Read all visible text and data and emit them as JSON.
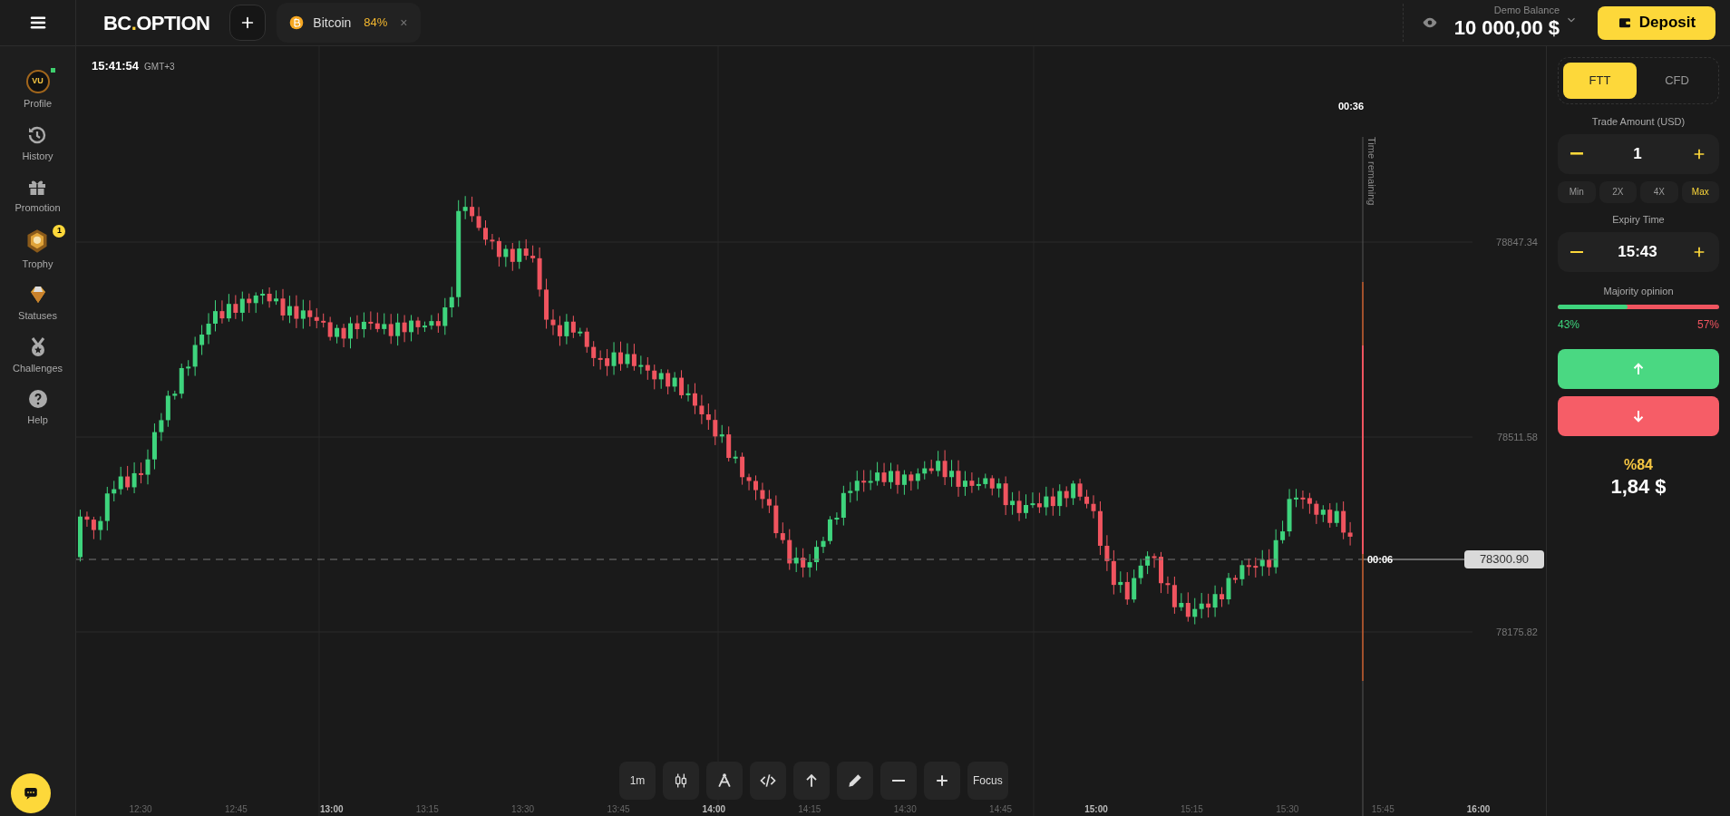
{
  "top_bar": {
    "logo_parts": [
      "BC",
      ".",
      "OPTION"
    ],
    "asset_tab": {
      "name": "Bitcoin",
      "payout": "84%",
      "close": "×"
    },
    "balance": {
      "label": "Demo Balance",
      "amount": "10 000,00 $"
    },
    "deposit_button": "Deposit"
  },
  "sidebar": {
    "items": [
      {
        "label": "Profile",
        "kind": "avatar",
        "avatar_text": "VU",
        "online": true
      },
      {
        "label": "History",
        "kind": "history"
      },
      {
        "label": "Promotion",
        "kind": "gift"
      },
      {
        "label": "Trophy",
        "kind": "trophy",
        "badge": "1"
      },
      {
        "label": "Statuses",
        "kind": "gem"
      },
      {
        "label": "Challenges",
        "kind": "medal"
      },
      {
        "label": "Help",
        "kind": "help"
      }
    ]
  },
  "chart": {
    "clock": "15:41:54",
    "timezone": "GMT+3",
    "price_levels": [
      "78847.34",
      "78511.58",
      "78175.82"
    ],
    "current_price": "78300.90",
    "countdown": "00:36",
    "time_remaining_label": "Time remaining",
    "candle_timer": "00:06",
    "time_axis": [
      {
        "label": "12:30",
        "major": false
      },
      {
        "label": "12:45",
        "major": false
      },
      {
        "label": "13:00",
        "major": true
      },
      {
        "label": "13:15",
        "major": false
      },
      {
        "label": "13:30",
        "major": false
      },
      {
        "label": "13:45",
        "major": false
      },
      {
        "label": "14:00",
        "major": true
      },
      {
        "label": "14:15",
        "major": false
      },
      {
        "label": "14:30",
        "major": false
      },
      {
        "label": "14:45",
        "major": false
      },
      {
        "label": "15:00",
        "major": true
      },
      {
        "label": "15:15",
        "major": false
      },
      {
        "label": "15:30",
        "major": false
      },
      {
        "label": "15:45",
        "major": false
      },
      {
        "label": "16:00",
        "major": true
      }
    ]
  },
  "toolbar": [
    {
      "kind": "text",
      "label": "1m"
    },
    {
      "kind": "candles"
    },
    {
      "kind": "compass"
    },
    {
      "kind": "code"
    },
    {
      "kind": "arrow"
    },
    {
      "kind": "pencil"
    },
    {
      "kind": "minus"
    },
    {
      "kind": "plus"
    },
    {
      "kind": "text",
      "label": "Focus"
    }
  ],
  "trade_panel": {
    "modes": [
      {
        "label": "FTT",
        "selected": true
      },
      {
        "label": "CFD",
        "selected": false
      }
    ],
    "amount_label": "Trade Amount (USD)",
    "amount": "1",
    "multipliers": [
      {
        "label": "Min",
        "selected": false
      },
      {
        "label": "2X",
        "selected": false
      },
      {
        "label": "4X",
        "selected": false
      },
      {
        "label": "Max",
        "selected": true
      }
    ],
    "expiry_label": "Expiry Time",
    "expiry": "15:43",
    "opinion_label": "Majority opinion",
    "opinion": {
      "level": 0.43,
      "up": "43%",
      "down": "57%"
    },
    "payout_percent": "%84",
    "payout_amount": "1,84 $"
  }
}
